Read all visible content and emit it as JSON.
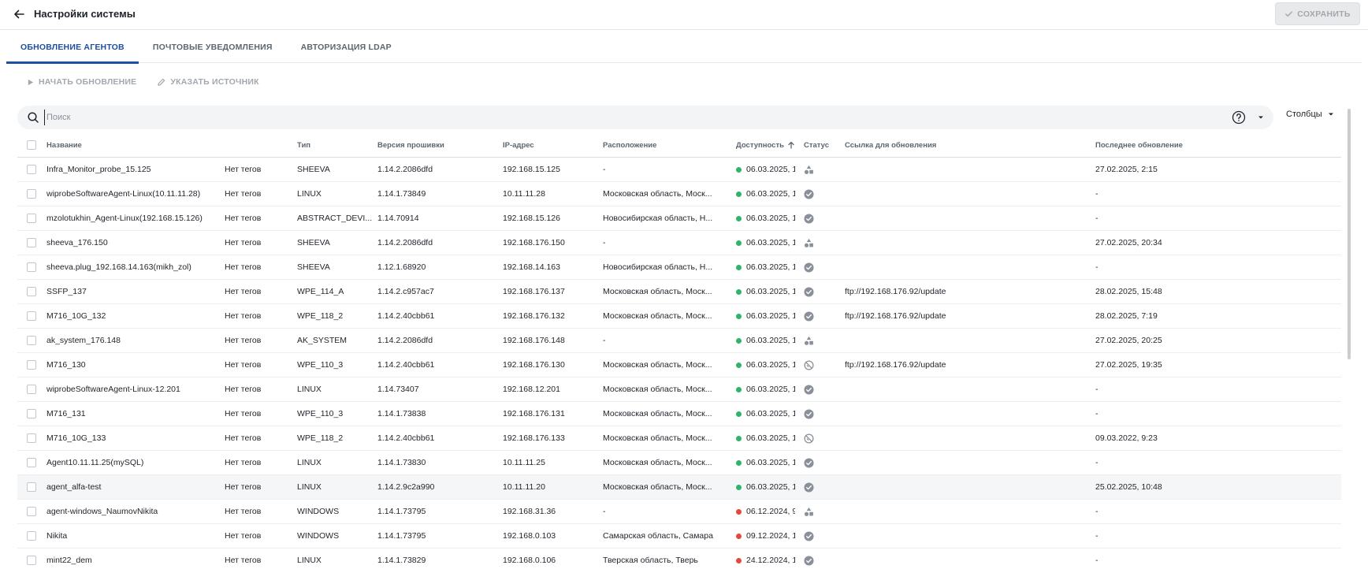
{
  "header": {
    "title": "Настройки системы",
    "save_label": "СОХРАНИТЬ"
  },
  "tabs": [
    {
      "label": "ОБНОВЛЕНИЕ АГЕНТОВ",
      "active": true
    },
    {
      "label": "ПОЧТОВЫЕ УВЕДОМЛЕНИЯ",
      "active": false
    },
    {
      "label": "АВТОРИЗАЦИЯ LDAP",
      "active": false
    }
  ],
  "toolbar": {
    "start_update": "НАЧАТЬ ОБНОВЛЕНИЕ",
    "set_source": "УКАЗАТЬ ИСТОЧНИК"
  },
  "search": {
    "placeholder": "Поиск",
    "columns_label": "Столбцы"
  },
  "colors": {
    "accent": "#1d4fa3",
    "online": "#2fb56a",
    "offline": "#e5483b",
    "status_icon": "#8a9099"
  },
  "table": {
    "headers": {
      "name": "Название",
      "type": "Тип",
      "firmware": "Версия прошивки",
      "ip": "IP-адрес",
      "location": "Расположение",
      "availability": "Доступность",
      "status": "Статус",
      "link": "Ссылка для обновления",
      "last_update": "Последнее обновление"
    },
    "sort": {
      "column": "availability",
      "direction": "asc"
    },
    "rows": [
      {
        "name": "Infra_Monitor_probe_15.125",
        "tags": "Нет тегов",
        "type": "SHEEVA",
        "firmware": "1.14.2.2086dfd",
        "ip": "192.168.15.125",
        "location": "-",
        "availability": "06.03.2025, 1",
        "online": true,
        "status_icon": "shapes-icon",
        "link": "",
        "last_update": "27.02.2025, 2:15"
      },
      {
        "name": "wiprobeSoftwareAgent-Linux(10.11.11.28)",
        "tags": "Нет тегов",
        "type": "LINUX",
        "firmware": "1.14.1.73849",
        "ip": "10.11.11.28",
        "location": "Московская область, Моск...",
        "availability": "06.03.2025, 1",
        "online": true,
        "status_icon": "check-circle-icon",
        "link": "",
        "last_update": "-"
      },
      {
        "name": "mzolotukhin_Agent-Linux(192.168.15.126)",
        "tags": "Нет тегов",
        "type": "ABSTRACT_DEVI...",
        "firmware": "1.14.70914",
        "ip": "192.168.15.126",
        "location": "Новосибирская область, Н...",
        "availability": "06.03.2025, 1",
        "online": true,
        "status_icon": "check-circle-icon",
        "link": "",
        "last_update": "-"
      },
      {
        "name": "sheeva_176.150",
        "tags": "Нет тегов",
        "type": "SHEEVA",
        "firmware": "1.14.2.2086dfd",
        "ip": "192.168.176.150",
        "location": "-",
        "availability": "06.03.2025, 1",
        "online": true,
        "status_icon": "shapes-icon",
        "link": "",
        "last_update": "27.02.2025, 20:34"
      },
      {
        "name": "sheeva.plug_192.168.14.163(mikh_zol)",
        "tags": "Нет тегов",
        "type": "SHEEVA",
        "firmware": "1.12.1.68920",
        "ip": "192.168.14.163",
        "location": "Новосибирская область, Н...",
        "availability": "06.03.2025, 1",
        "online": true,
        "status_icon": "check-circle-icon",
        "link": "",
        "last_update": "-"
      },
      {
        "name": "SSFP_137",
        "tags": "Нет тегов",
        "type": "WPE_114_A",
        "firmware": "1.14.2.c957ac7",
        "ip": "192.168.176.137",
        "location": "Московская область, Моск...",
        "availability": "06.03.2025, 1",
        "online": true,
        "status_icon": "check-circle-icon",
        "link": "ftp://192.168.176.92/update",
        "last_update": "28.02.2025, 15:48"
      },
      {
        "name": "M716_10G_132",
        "tags": "Нет тегов",
        "type": "WPE_118_2",
        "firmware": "1.14.2.40cbb61",
        "ip": "192.168.176.132",
        "location": "Московская область, Моск...",
        "availability": "06.03.2025, 1",
        "online": true,
        "status_icon": "check-circle-icon",
        "link": "ftp://192.168.176.92/update",
        "last_update": "28.02.2025, 7:19"
      },
      {
        "name": "ak_system_176.148",
        "tags": "Нет тегов",
        "type": "AK_SYSTEM",
        "firmware": "1.14.2.2086dfd",
        "ip": "192.168.176.148",
        "location": "-",
        "availability": "06.03.2025, 1",
        "online": true,
        "status_icon": "shapes-icon",
        "link": "",
        "last_update": "27.02.2025, 20:25"
      },
      {
        "name": "M716_130",
        "tags": "Нет тегов",
        "type": "WPE_110_3",
        "firmware": "1.14.2.40cbb61",
        "ip": "192.168.176.130",
        "location": "Московская область, Моск...",
        "availability": "06.03.2025, 1",
        "online": true,
        "status_icon": "blocked-icon",
        "link": "ftp://192.168.176.92/update",
        "last_update": "27.02.2025, 19:35"
      },
      {
        "name": "wiprobeSoftwareAgent-Linux-12.201",
        "tags": "Нет тегов",
        "type": "LINUX",
        "firmware": "1.14.73407",
        "ip": "192.168.12.201",
        "location": "Московская область, Моск...",
        "availability": "06.03.2025, 1",
        "online": true,
        "status_icon": "check-circle-icon",
        "link": "",
        "last_update": "-"
      },
      {
        "name": "M716_131",
        "tags": "Нет тегов",
        "type": "WPE_110_3",
        "firmware": "1.14.1.73838",
        "ip": "192.168.176.131",
        "location": "Московская область, Моск...",
        "availability": "06.03.2025, 1",
        "online": true,
        "status_icon": "check-circle-icon",
        "link": "",
        "last_update": "-"
      },
      {
        "name": "M716_10G_133",
        "tags": "Нет тегов",
        "type": "WPE_118_2",
        "firmware": "1.14.2.40cbb61",
        "ip": "192.168.176.133",
        "location": "Московская область, Моск...",
        "availability": "06.03.2025, 1",
        "online": true,
        "status_icon": "blocked-icon",
        "link": "",
        "last_update": "09.03.2022, 9:23"
      },
      {
        "name": "Agent10.11.11.25(mySQL)",
        "tags": "Нет тегов",
        "type": "LINUX",
        "firmware": "1.14.1.73830",
        "ip": "10.11.11.25",
        "location": "Московская область, Моск...",
        "availability": "06.03.2025, 1",
        "online": true,
        "status_icon": "check-circle-icon",
        "link": "",
        "last_update": "-"
      },
      {
        "name": "agent_alfa-test",
        "tags": "Нет тегов",
        "type": "LINUX",
        "firmware": "1.14.2.9c2a990",
        "ip": "10.11.11.20",
        "location": "Московская область, Моск...",
        "availability": "06.03.2025, 1",
        "online": true,
        "status_icon": "check-circle-icon",
        "link": "",
        "last_update": "25.02.2025, 10:48",
        "highlight": true
      },
      {
        "name": "agent-windows_NaumovNikita",
        "tags": "Нет тегов",
        "type": "WINDOWS",
        "firmware": "1.14.1.73795",
        "ip": "192.168.31.36",
        "location": "-",
        "availability": "06.12.2024, 9",
        "online": false,
        "status_icon": "shapes-icon",
        "link": "",
        "last_update": "-"
      },
      {
        "name": "Nikita",
        "tags": "Нет тегов",
        "type": "WINDOWS",
        "firmware": "1.14.1.73795",
        "ip": "192.168.0.103",
        "location": "Самарская область, Самара",
        "availability": "09.12.2024, 1",
        "online": false,
        "status_icon": "check-circle-icon",
        "link": "",
        "last_update": "-"
      },
      {
        "name": "mint22_dem",
        "tags": "Нет тегов",
        "type": "LINUX",
        "firmware": "1.14.1.73829",
        "ip": "192.168.0.106",
        "location": "Тверская область, Тверь",
        "availability": "24.12.2024, 1",
        "online": false,
        "status_icon": "check-circle-icon",
        "link": "",
        "last_update": "-"
      }
    ]
  }
}
